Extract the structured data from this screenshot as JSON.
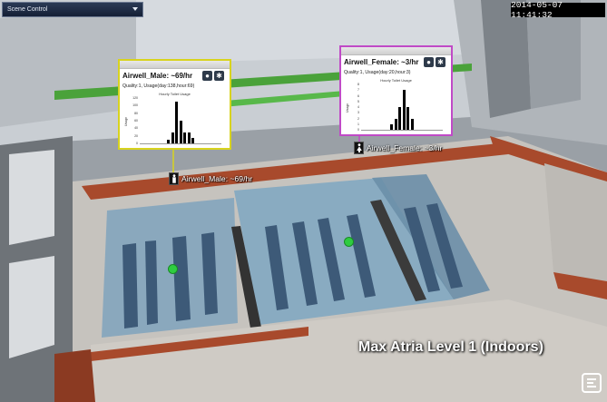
{
  "scene_control": {
    "label": "Scene Control"
  },
  "datetime": "2014-05-07 11:41:32",
  "caption": "Max Atria Level 1 (Indoors)",
  "popups": [
    {
      "title": "Airwell_Male: ~69/hr",
      "subtitle": "Quality:1, Usage(day:138,hour:69)",
      "border_color": "#d8d31e",
      "chart_data": {
        "type": "bar",
        "title": "Hourly Toilet Usage",
        "ylabel": "Usage",
        "ylim": [
          0,
          120
        ],
        "yticks": [
          "120",
          "100",
          "80",
          "60",
          "40",
          "20",
          "0"
        ],
        "values": [
          10,
          30,
          110,
          60,
          30,
          30,
          15
        ]
      }
    },
    {
      "title": "Airwell_Female: ~3/hr",
      "subtitle": "Quality:1, Usage(day:20,hour:3)",
      "border_color": "#c04ac7",
      "chart_data": {
        "type": "bar",
        "title": "Hourly Toilet Usage",
        "ylabel": "Usage",
        "ylim": [
          0,
          8
        ],
        "yticks": [
          "8",
          "7",
          "6",
          "5",
          "4",
          "3",
          "2",
          "1",
          "0"
        ],
        "values": [
          1,
          2,
          4,
          7,
          4,
          2
        ]
      }
    }
  ],
  "tags": [
    {
      "label": "Airwell_Male: ~69/hr",
      "icon": "male-restroom-icon"
    },
    {
      "label": "Airwell_Female: ~3/hr",
      "icon": "female-restroom-icon"
    }
  ],
  "colors": {
    "male_accent": "#d8d31e",
    "female_accent": "#c04ac7",
    "status_ok": "#2ecc40"
  }
}
